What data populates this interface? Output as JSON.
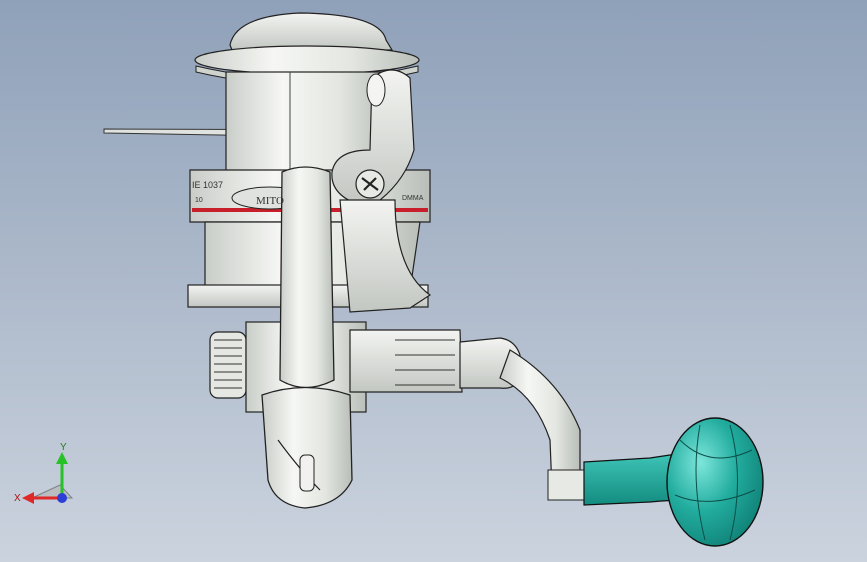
{
  "model": {
    "name": "spinning-reel-3d-model",
    "brand_text_left": "MITO",
    "spool_text_left": "IE 1037",
    "spool_text_small": "10",
    "spool_text_right": "DMMA"
  },
  "triad": {
    "x_label": "X",
    "y_label": "Y"
  },
  "colors": {
    "background_top": "#8fa1b9",
    "background_bottom": "#cbd3de",
    "body": "#e9ece8",
    "knob": "#1fa79b",
    "stripe": "#c8202a"
  }
}
